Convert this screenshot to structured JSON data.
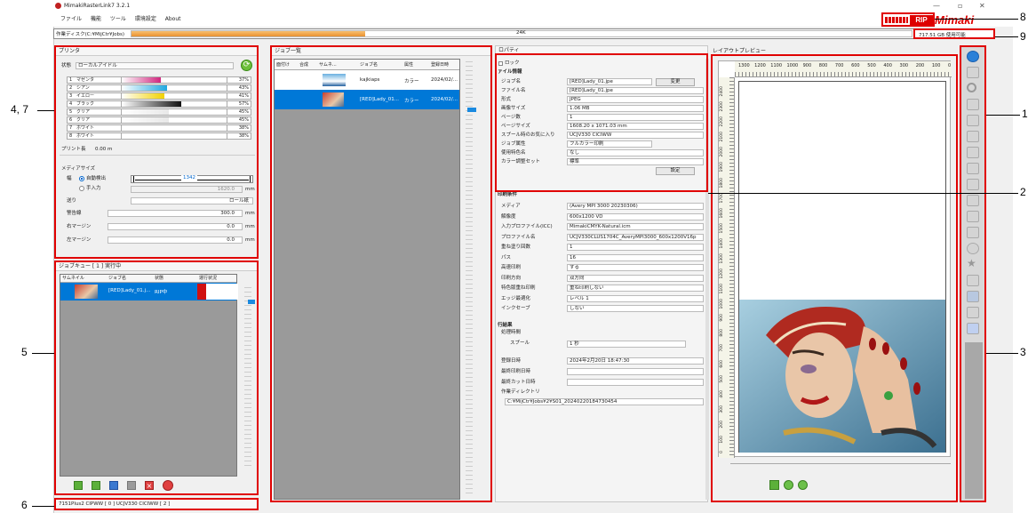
{
  "app": {
    "title": "MimakiRasterLink7 3.2.1"
  },
  "menu": [
    "ファイル",
    "機能",
    "ツール",
    "環境設定",
    "About"
  ],
  "workdisk": {
    "label": "作業ディスク(C:¥MijCtr¥Jobs)",
    "progress_text": "24K",
    "free_space": "717.51 GB 使用可能"
  },
  "printer": {
    "panel_title": "プリンタ",
    "status_label": "状態",
    "status_value": "ローカルアイドル",
    "inks": [
      {
        "slot": "1",
        "name": "マゼンタ",
        "pct": "37%",
        "level": 0.37,
        "color": "#d0267e"
      },
      {
        "slot": "2",
        "name": "シアン",
        "pct": "43%",
        "level": 0.43,
        "color": "#20a8e0"
      },
      {
        "slot": "3",
        "name": "イエロー",
        "pct": "41%",
        "level": 0.41,
        "color": "#f2d200"
      },
      {
        "slot": "4",
        "name": "ブラック",
        "pct": "57%",
        "level": 0.57,
        "color": "#111111"
      },
      {
        "slot": "5",
        "name": "クリア",
        "pct": "45%",
        "level": 0.45,
        "color": "#e8e8e8"
      },
      {
        "slot": "6",
        "name": "クリア",
        "pct": "45%",
        "level": 0.45,
        "color": "#e8e8e8"
      },
      {
        "slot": "7",
        "name": "ホワイト",
        "pct": "38%",
        "level": 0.38,
        "color": "#ffffff"
      },
      {
        "slot": "8",
        "name": "ホワイト",
        "pct": "38%",
        "level": 0.38,
        "color": "#ffffff"
      }
    ],
    "print_length_label": "プリント長",
    "print_length_value": "0.00 m",
    "media_size_label": "メディアサイズ",
    "width_label": "幅",
    "auto_detect_label": "自動検出",
    "manual_label": "手入力",
    "width_value": "1342",
    "manual_value": "1620.0",
    "unit": "mm",
    "feed_label": "送り",
    "feed_value": "ロール紙",
    "warning_label": "警告線",
    "warning_value": "300.0",
    "right_margin_label": "右マージン",
    "right_margin_value": "0.0",
    "left_margin_label": "左マージン",
    "left_margin_value": "0.0"
  },
  "job_queue": {
    "title": "ジョブキュー [ 1 ] 実行中",
    "columns": [
      "サムネイル",
      "ジョブ名",
      "状態",
      "運行状況"
    ],
    "rows": [
      {
        "name": "[RED]Lady_01.j...",
        "status": "RIP中"
      }
    ]
  },
  "statusbar": {
    "text": "7151Plus2 CIPWW [ 0 ]   UCJV330 CICIWW [ 2 ]"
  },
  "job_list": {
    "title": "ジョブ一覧",
    "columns": [
      "面付け",
      "合成",
      "サムネ...",
      "ジョブ名",
      "属性",
      "登録日時"
    ],
    "rows": [
      {
        "name": "kajkiaps",
        "attr": "カラー",
        "date": "2024/02/..."
      },
      {
        "name": "[RED]Lady_01...",
        "attr": "カラー",
        "date": "2024/02/..."
      }
    ]
  },
  "properties": {
    "title": "ロパティ",
    "lock_label": "ロック",
    "file_info_title": "ァイル情報",
    "file_rows": [
      {
        "label": "ジョブ名",
        "value": "[RED]Lady_01.jpe"
      },
      {
        "label": "ファイル名",
        "value": "[RED]Lady_01.jpe"
      },
      {
        "label": "形式",
        "value": "JPEG"
      },
      {
        "label": "画像サイズ",
        "value": "1.06 MB"
      },
      {
        "label": "ページ数",
        "value": "1"
      },
      {
        "label": "ページサイズ",
        "value": "1608.20 x 1071.03 mm"
      },
      {
        "label": "スプール時のお気に入り",
        "value": "UCJV330 CICIWW"
      },
      {
        "label": "ジョブ属性",
        "value": "フルカラー印刷"
      },
      {
        "label": "使用特色名",
        "value": "なし"
      },
      {
        "label": "カラー調整セット",
        "value": "標準"
      }
    ],
    "change_button": "変更",
    "settings_button": "設定",
    "print_cond_title": "印刷条件",
    "cond_rows": [
      {
        "label": "メディア",
        "value": "(Avery MPI 3000 20230306)"
      },
      {
        "label": "解像度",
        "value": "600x1200 VD"
      },
      {
        "label": "入力プロファイル(ICC)",
        "value": "MimakiCMYK-Natural.icm"
      },
      {
        "label": "プロファイル名",
        "value": "UCJV330CLUS1704C_AveryMPI3000_600x1200V16p"
      },
      {
        "label": "重ね塗り回数",
        "value": "1"
      },
      {
        "label": "パス",
        "value": "16"
      },
      {
        "label": "高速印刷",
        "value": "する"
      },
      {
        "label": "印刷方向",
        "value": "双方向"
      },
      {
        "label": "特色版重ね印刷",
        "value": "重ね印刷しない"
      },
      {
        "label": "エッジ最適化",
        "value": "レベル 1"
      },
      {
        "label": "インクセーブ",
        "value": "しない"
      }
    ],
    "result_title": "行結果",
    "processing_time_label": "処理時間",
    "spool_label": "スプール",
    "spool_value": "1 秒",
    "reg_date_label": "登録日時",
    "reg_date_value": "2024年2月20日 18:47:30",
    "last_print_label": "最終印刷日時",
    "last_cut_label": "最終カット日時",
    "workdir_label": "作業ディレクトリ",
    "workdir_value": "C:¥MijCtr¥Jobs¥2¥S01_20240220184730454"
  },
  "layout_preview": {
    "title": "レイアウトプレビュー",
    "ruler_top": [
      "1300",
      "1200",
      "1100",
      "1000",
      "900",
      "800",
      "700",
      "600",
      "500",
      "400",
      "300",
      "200",
      "100",
      "0"
    ],
    "ruler_left": [
      "0",
      "100",
      "200",
      "300",
      "400",
      "500",
      "600",
      "700",
      "800",
      "900",
      "1000",
      "1100",
      "1200",
      "1300",
      "1400",
      "1500",
      "1600",
      "1700",
      "1800",
      "1900",
      "2000",
      "2100",
      "2200",
      "2300",
      "2400"
    ]
  },
  "brand": {
    "logo": "Mimaki",
    "rip_badge": "RIP"
  },
  "callouts": [
    "1",
    "2",
    "3",
    "4, 7",
    "5",
    "6",
    "8",
    "9"
  ]
}
